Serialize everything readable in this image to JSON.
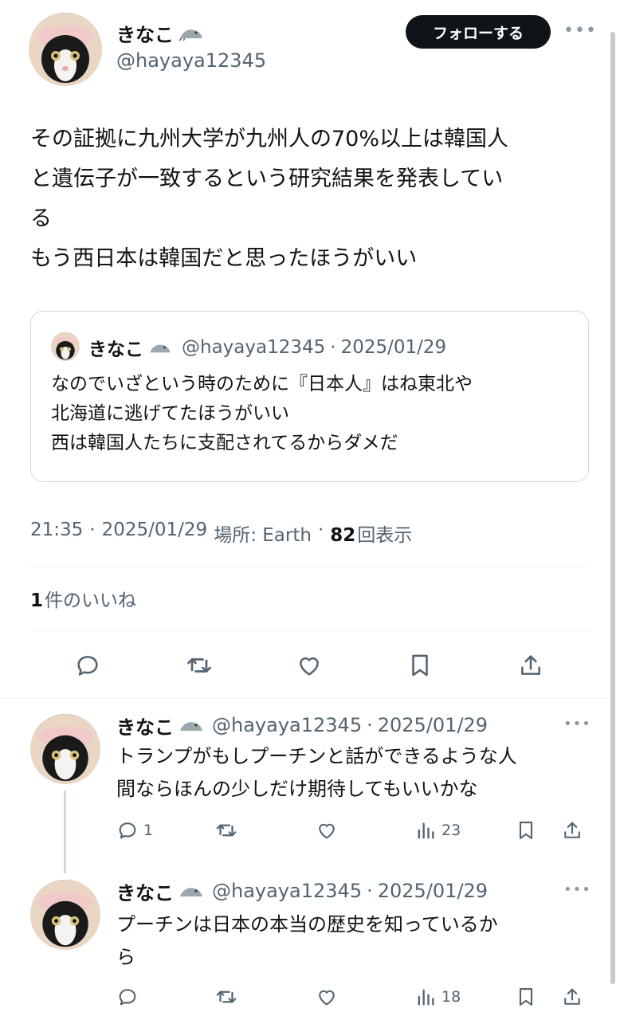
{
  "main_tweet": {
    "author_name": "きなこ",
    "author_handle": "@hayaya12345",
    "follow_label": "フォローする",
    "more_label": "•••",
    "text": "その証拠に九州大学が九州人の70%以上は韓国人\nと遺伝子が一致するという研究結果を発表してい\nる\nもう西日本は韓国だと思ったほうがいい",
    "quote": {
      "author_name": "きなこ",
      "author_handle": "@hayaya12345",
      "sep": "·",
      "date": "2025/01/29",
      "text": "なのでいざという時のために『日本人』はね東北や\n北海道に逃げてたほうがいい\n西は韓国人たちに支配されてるからダメだ"
    },
    "meta": {
      "time": "21:35",
      "sep1": "·",
      "date": "2025/01/29",
      "location_label": "場所: Earth",
      "sep2": "·",
      "views_count": "82",
      "views_label": "回表示"
    },
    "likes": {
      "count": "1",
      "label": "件のいいね"
    }
  },
  "replies": [
    {
      "author_name": "きなこ",
      "author_handle": "@hayaya12345",
      "sep": "·",
      "date": "2025/01/29",
      "text": "トランプがもしプーチンと話ができるような人\n間ならほんの少しだけ期待してもいいかな",
      "reply_count": "1",
      "views_count": "23"
    },
    {
      "author_name": "きなこ",
      "author_handle": "@hayaya12345",
      "sep": "·",
      "date": "2025/01/29",
      "text": "プーチンは日本の本当の歴史を知っているか\nら",
      "reply_count": "",
      "views_count": "18"
    }
  ],
  "icons": {
    "emoji": "seal-emoji-icon",
    "reply": "reply-icon",
    "retweet": "retweet-icon",
    "like": "like-icon",
    "bookmark": "bookmark-icon",
    "share": "share-icon",
    "views": "views-icon"
  },
  "colors": {
    "text": "#0f1419",
    "muted": "#536471",
    "border": "#cfd9de",
    "follow_bg": "#0f1419"
  }
}
